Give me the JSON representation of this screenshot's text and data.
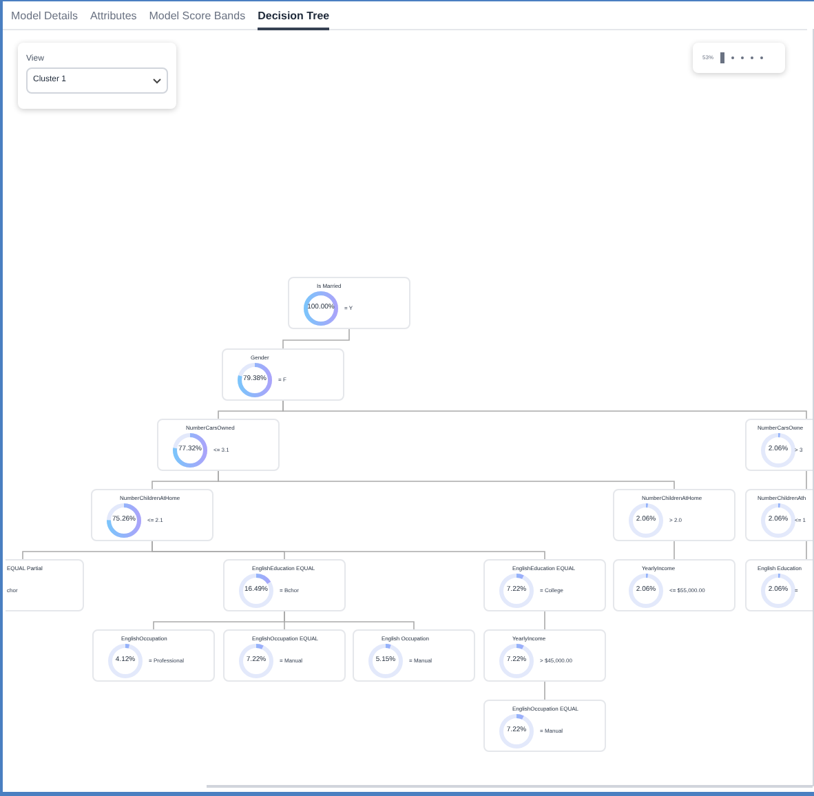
{
  "tabs": [
    {
      "label": "Model Details",
      "selected": false
    },
    {
      "label": "Attributes",
      "selected": false
    },
    {
      "label": "Model Score Bands",
      "selected": false
    },
    {
      "label": "Decision Tree",
      "selected": true
    }
  ],
  "view": {
    "label": "View",
    "value": "Cluster 1"
  },
  "zoom": {
    "reading": "53%"
  },
  "tree": {
    "label": "Is Married",
    "percent": "100.00%",
    "condition": "= Y",
    "level": 1.0,
    "children": [
      {
        "label": "Gender",
        "percent": "79.38%",
        "condition": "= F",
        "level": 0.79,
        "children": [
          {
            "label": "NumberCarsOwned",
            "percent": "77.32%",
            "condition": "<= 3.1",
            "level": 0.77,
            "children": [
              {
                "label": "NumberChildrenAtHome",
                "percent": "75.26%",
                "condition": "<= 2.1",
                "level": 0.75,
                "children": [
                  {
                    "label": "EQUAL Partial",
                    "condition": "chor"
                  },
                  {
                    "label": "EnglishEducation EQUAL",
                    "percent": "16.49%",
                    "condition": "= Bchor",
                    "level": 0.16,
                    "children": [
                      {
                        "label": "EnglishOccupation",
                        "percent": "4.12%",
                        "condition": "= Professional",
                        "level": 0.04
                      },
                      {
                        "label": "EnglishOccupation EQUAL",
                        "percent": "7.22%",
                        "condition": "= Manual",
                        "level": 0.07
                      },
                      {
                        "label": "English Occupation",
                        "percent": "5.15%",
                        "condition": "= Manual",
                        "level": 0.05
                      }
                    ]
                  },
                  {
                    "label": "EnglishEducation EQUAL",
                    "percent": "7.22%",
                    "condition": "= College",
                    "level": 0.07,
                    "children": [
                      {
                        "label": "YearlyIncome",
                        "percent": "7.22%",
                        "condition": "> $45,000.00",
                        "level": 0.07,
                        "children": [
                          {
                            "label": "EnglishOccupation EQUAL",
                            "percent": "7.22%",
                            "condition": "= Manual",
                            "level": 0.07
                          }
                        ]
                      }
                    ]
                  }
                ]
              },
              {
                "label": "NumberChildrenAtHome",
                "percent": "2.06%",
                "condition": "> 2.0",
                "level": 0.02,
                "children": [
                  {
                    "label": "YearlyIncome",
                    "percent": "2.06%",
                    "condition": "<= $55,000.00",
                    "level": 0.02
                  }
                ]
              }
            ]
          },
          {
            "label": "NumberCarsOwne",
            "percent": "2.06%",
            "condition": "> 3",
            "level": 0.02,
            "children": [
              {
                "label": "NumberChildrenAth",
                "percent": "2.06%",
                "condition": "<= 1",
                "level": 0.02,
                "children": [
                  {
                    "label": "English Education",
                    "percent": "2.06%",
                    "condition": "=",
                    "level": 0.02
                  }
                ]
              }
            ]
          }
        ]
      }
    ]
  }
}
